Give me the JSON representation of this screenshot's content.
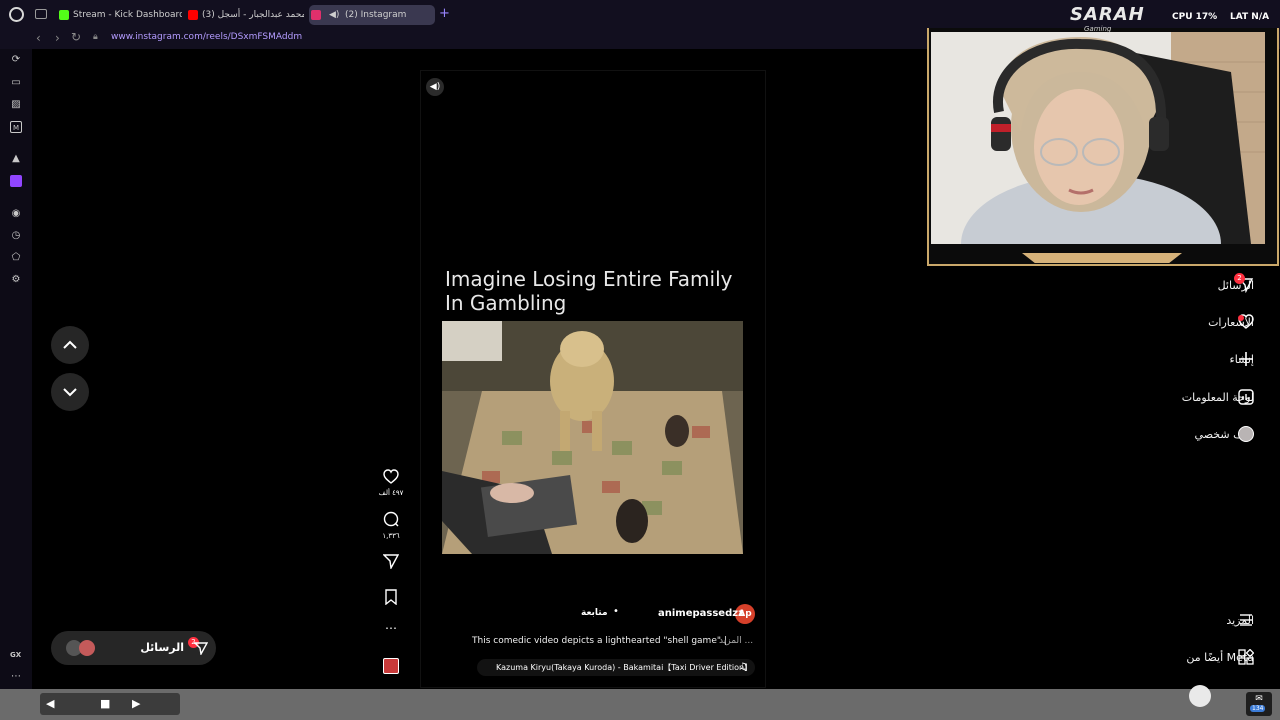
{
  "browser": {
    "tabs": [
      {
        "label": "Stream - Kick Dashboard",
        "color": "#53fc18"
      },
      {
        "label": "(3) محمد عبدالجبار - أسجل ..",
        "color": "#ff0000"
      },
      {
        "label": "(2) Instagram",
        "color": "#e1306c"
      }
    ],
    "url": "www.instagram.com/reels/DSxmFSMAddm"
  },
  "sidebar": {
    "icons": [
      "reload-icon",
      "bag-icon",
      "stats-icon",
      "m-icon",
      "aria-icon",
      "twitch-icon",
      "player-icon",
      "history-icon",
      "extensions-icon",
      "settings-icon"
    ],
    "gx_label": "GX"
  },
  "reel": {
    "caption_line1": "Imagine Losing Entire Family",
    "caption_line2": "In Gambling",
    "author": "animepassedzz",
    "author_initials": "Ap",
    "follow": "متابعة",
    "description": "This comedic video depicts a lighthearted \"shell game\" |",
    "more": "المزيد ...",
    "music": "Kazuma Kiryu(Takaya Kuroda) - Bakamitai【Taxi Driver Edition】",
    "likes": "٤٩٧ ألف",
    "comments": "١,٣٣٦"
  },
  "right_nav": {
    "messages": "الرسائل",
    "messages_badge": "2",
    "notifications": "الإشعارات",
    "create": "إنشاء",
    "dashboard": "لوحة المعلومات",
    "profile": "ملف شخصي",
    "more": "المزيد",
    "also_from_meta": "أيضًا من Meta"
  },
  "messages_pill": {
    "label": "الرسائل",
    "badge": "2"
  },
  "overlay": {
    "logo": "SARAH",
    "logo_sub": "Gaming",
    "cpu_label": "CPU",
    "cpu_value": "17%",
    "lat_label": "LAT",
    "lat_value": "N/A"
  },
  "taskbar": {
    "notification_count": "134"
  }
}
